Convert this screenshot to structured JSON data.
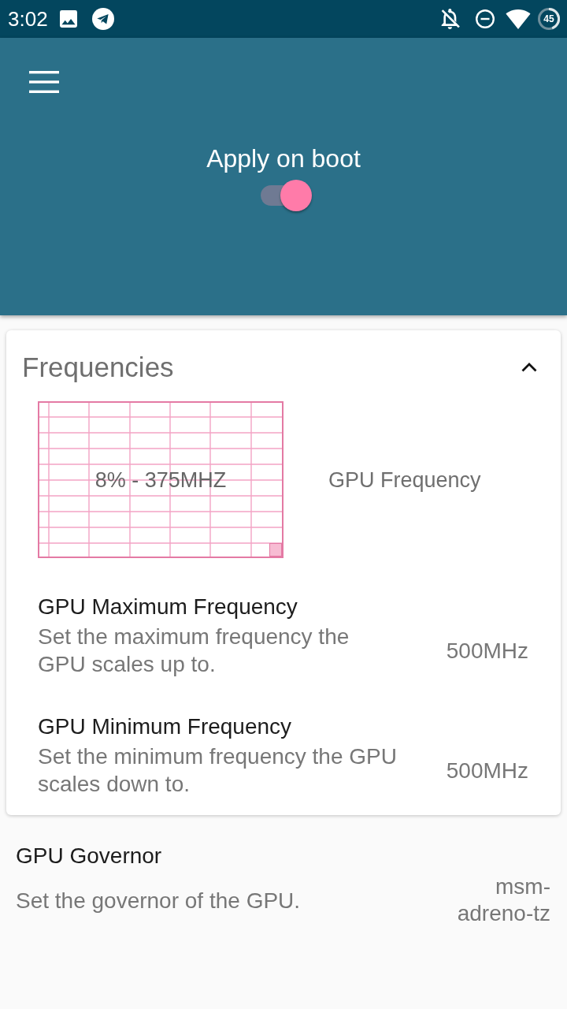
{
  "status_bar": {
    "time": "3:02",
    "battery": "45"
  },
  "header": {
    "apply_on_boot": {
      "label": "Apply on boot",
      "on": true
    }
  },
  "frequencies": {
    "title": "Frequencies",
    "expanded": true,
    "graph": {
      "reading": "8% - 375MHZ",
      "label": "GPU Frequency"
    },
    "items": [
      {
        "title": "GPU Maximum Frequency",
        "description": "Set the maximum frequency the\nGPU scales up to.",
        "value": "500MHz"
      },
      {
        "title": "GPU Minimum Frequency",
        "description": "Set the minimum frequency the GPU\nscales down to.",
        "value": "500MHz"
      }
    ]
  },
  "governor": {
    "title": "GPU Governor",
    "description": "Set the governor of the GPU.",
    "value": "msm-adreno-tz"
  }
}
